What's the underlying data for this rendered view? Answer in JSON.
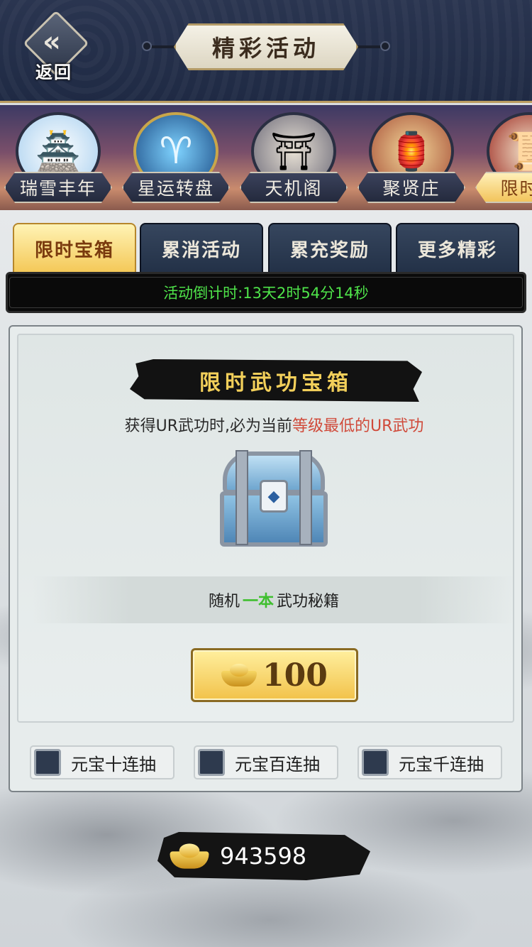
{
  "header": {
    "back_label": "返回",
    "title": "精彩活动"
  },
  "events": [
    {
      "label": "瑞雪丰年",
      "icon": "snow-palace-icon"
    },
    {
      "label": "星运转盘",
      "icon": "aries-wheel-icon"
    },
    {
      "label": "天机阁",
      "icon": "pavilion-icon"
    },
    {
      "label": "聚贤庄",
      "icon": "manor-icon"
    },
    {
      "label": "限时宝",
      "icon": "scroll-icon",
      "active": true
    }
  ],
  "tabs": [
    {
      "label": "限时宝箱",
      "active": true
    },
    {
      "label": "累消活动"
    },
    {
      "label": "累充奖励"
    },
    {
      "label": "更多精彩"
    }
  ],
  "countdown": "活动倒计时:13天2时54分14秒",
  "panel": {
    "banner": "限时武功宝箱",
    "desc_prefix": "获得UR武功时,必为当前",
    "desc_highlight": "等级最低的UR武功",
    "chest_icon": "blue-treasure-chest-icon",
    "reward_prefix": "随机",
    "reward_qty": "一本",
    "reward_item": "武功秘籍",
    "price": "100",
    "options": [
      "元宝十连抽",
      "元宝百连抽",
      "元宝千连抽"
    ]
  },
  "currency": {
    "icon": "gold-ingot-icon",
    "value": "943598"
  },
  "colors": {
    "countdown_text": "#4fe44a",
    "highlight_red": "#d04a3a",
    "qty_green": "#3fbf2f",
    "banner_gold": "#f2cf5a"
  }
}
